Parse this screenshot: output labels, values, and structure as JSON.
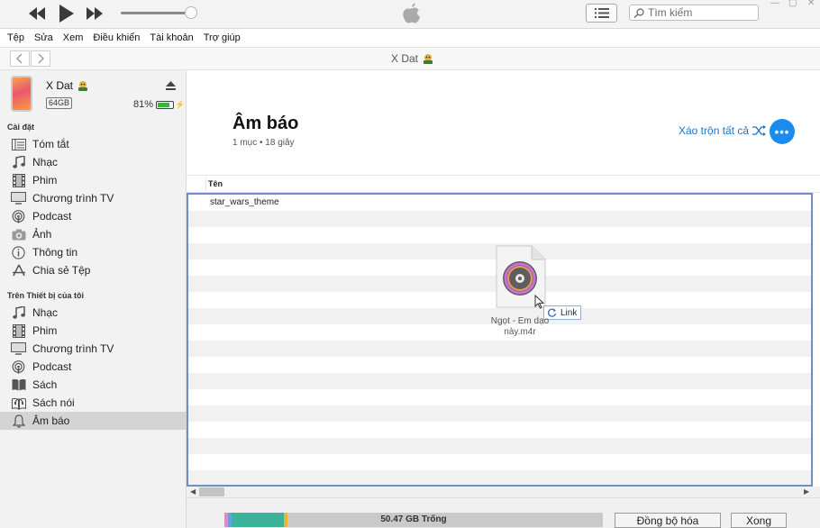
{
  "toolbar": {
    "search_placeholder": "Tìm kiếm",
    "volume_level": 0.92
  },
  "menu": [
    "Tệp",
    "Sửa",
    "Xem",
    "Điều khiển",
    "Tài khoản",
    "Trợ giúp"
  ],
  "nav": {
    "device_title": "X Dat"
  },
  "device": {
    "name": "X Dat",
    "capacity": "64GB",
    "battery": "81%",
    "battery_level": 0.81
  },
  "sidebar": {
    "settings_header": "Cài đặt",
    "settings_items": [
      {
        "label": "Tóm tắt",
        "icon": "summary-icon"
      },
      {
        "label": "Nhạc",
        "icon": "music-note-icon"
      },
      {
        "label": "Phim",
        "icon": "film-icon"
      },
      {
        "label": "Chương trình TV",
        "icon": "tv-icon"
      },
      {
        "label": "Podcast",
        "icon": "podcast-icon"
      },
      {
        "label": "Ảnh",
        "icon": "camera-icon"
      },
      {
        "label": "Thông tin",
        "icon": "info-icon"
      },
      {
        "label": "Chia sẻ Tệp",
        "icon": "app-store-icon"
      }
    ],
    "device_header": "Trên Thiết bị của tôi",
    "device_items": [
      {
        "label": "Nhạc",
        "icon": "music-note-icon"
      },
      {
        "label": "Phim",
        "icon": "film-icon"
      },
      {
        "label": "Chương trình TV",
        "icon": "tv-icon"
      },
      {
        "label": "Podcast",
        "icon": "podcast-icon"
      },
      {
        "label": "Sách",
        "icon": "book-icon"
      },
      {
        "label": "Sách nói",
        "icon": "audiobook-icon"
      },
      {
        "label": "Âm báo",
        "icon": "bell-icon",
        "active": true
      }
    ]
  },
  "main": {
    "title": "Âm báo",
    "meta": "1 mục • 18 giây",
    "shuffle_label": "Xáo trộn tất cả",
    "column_name": "Tên",
    "rows": [
      "star_wars_theme"
    ],
    "drag_file_line1": "Ngọt - Em dạo",
    "drag_file_line2": "này.m4r",
    "drag_tooltip": "Link"
  },
  "footer": {
    "storage_label": "50.47 GB Trống",
    "sync_button": "Đồng bộ hóa",
    "done_button": "Xong"
  },
  "colors": {
    "accent": "#1a8cf0",
    "link": "#1a73c9",
    "selection_border": "#6f8ec3"
  }
}
